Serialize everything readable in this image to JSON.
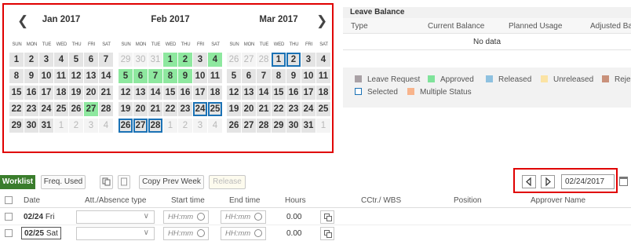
{
  "calendar": {
    "weekday_labels": [
      "SUN",
      "MON",
      "TUE",
      "WED",
      "THU",
      "FRI",
      "SAT"
    ],
    "prev_icon": "chevron-left-icon",
    "next_icon": "chevron-right-icon",
    "months": [
      {
        "title": "Jan 2017",
        "weeks": [
          [
            {
              "d": "1"
            },
            {
              "d": "2"
            },
            {
              "d": "3"
            },
            {
              "d": "4"
            },
            {
              "d": "5"
            },
            {
              "d": "6"
            },
            {
              "d": "7"
            }
          ],
          [
            {
              "d": "8"
            },
            {
              "d": "9"
            },
            {
              "d": "10"
            },
            {
              "d": "11"
            },
            {
              "d": "12"
            },
            {
              "d": "13"
            },
            {
              "d": "14"
            }
          ],
          [
            {
              "d": "15"
            },
            {
              "d": "16"
            },
            {
              "d": "17"
            },
            {
              "d": "18"
            },
            {
              "d": "19"
            },
            {
              "d": "20"
            },
            {
              "d": "21"
            }
          ],
          [
            {
              "d": "22"
            },
            {
              "d": "23"
            },
            {
              "d": "24"
            },
            {
              "d": "25"
            },
            {
              "d": "26"
            },
            {
              "d": "27",
              "s": "approved"
            },
            {
              "d": "28"
            }
          ],
          [
            {
              "d": "29"
            },
            {
              "d": "30"
            },
            {
              "d": "31"
            },
            {
              "d": "1",
              "s": "other"
            },
            {
              "d": "2",
              "s": "other"
            },
            {
              "d": "3",
              "s": "other"
            },
            {
              "d": "4",
              "s": "other"
            }
          ]
        ]
      },
      {
        "title": "Feb 2017",
        "weeks": [
          [
            {
              "d": "29",
              "s": "other"
            },
            {
              "d": "30",
              "s": "other"
            },
            {
              "d": "31",
              "s": "other"
            },
            {
              "d": "1",
              "s": "approved"
            },
            {
              "d": "2",
              "s": "approved"
            },
            {
              "d": "3"
            },
            {
              "d": "4",
              "s": "approved"
            }
          ],
          [
            {
              "d": "5",
              "s": "approved"
            },
            {
              "d": "6",
              "s": "approved"
            },
            {
              "d": "7",
              "s": "approved"
            },
            {
              "d": "8",
              "s": "approved"
            },
            {
              "d": "9",
              "s": "approved"
            },
            {
              "d": "10"
            },
            {
              "d": "11"
            }
          ],
          [
            {
              "d": "12"
            },
            {
              "d": "13"
            },
            {
              "d": "14"
            },
            {
              "d": "15"
            },
            {
              "d": "16"
            },
            {
              "d": "17"
            },
            {
              "d": "18"
            }
          ],
          [
            {
              "d": "19"
            },
            {
              "d": "20"
            },
            {
              "d": "21"
            },
            {
              "d": "22"
            },
            {
              "d": "23"
            },
            {
              "d": "24",
              "s": "selected"
            },
            {
              "d": "25",
              "s": "selected"
            }
          ],
          [
            {
              "d": "26",
              "s": "selected"
            },
            {
              "d": "27",
              "s": "selected"
            },
            {
              "d": "28",
              "s": "selected"
            },
            {
              "d": "1",
              "s": "other"
            },
            {
              "d": "2",
              "s": "other"
            },
            {
              "d": "3",
              "s": "other"
            },
            {
              "d": "4",
              "s": "other"
            }
          ]
        ]
      },
      {
        "title": "Mar 2017",
        "weeks": [
          [
            {
              "d": "26",
              "s": "other"
            },
            {
              "d": "27",
              "s": "other"
            },
            {
              "d": "28",
              "s": "other"
            },
            {
              "d": "1",
              "s": "selected"
            },
            {
              "d": "2",
              "s": "selected"
            },
            {
              "d": "3"
            },
            {
              "d": "4"
            }
          ],
          [
            {
              "d": "5"
            },
            {
              "d": "6"
            },
            {
              "d": "7"
            },
            {
              "d": "8"
            },
            {
              "d": "9"
            },
            {
              "d": "10"
            },
            {
              "d": "11"
            }
          ],
          [
            {
              "d": "12"
            },
            {
              "d": "13"
            },
            {
              "d": "14"
            },
            {
              "d": "15"
            },
            {
              "d": "16"
            },
            {
              "d": "17"
            },
            {
              "d": "18"
            }
          ],
          [
            {
              "d": "19"
            },
            {
              "d": "20"
            },
            {
              "d": "21"
            },
            {
              "d": "22"
            },
            {
              "d": "23"
            },
            {
              "d": "24"
            },
            {
              "d": "25"
            }
          ],
          [
            {
              "d": "26"
            },
            {
              "d": "27"
            },
            {
              "d": "28"
            },
            {
              "d": "29"
            },
            {
              "d": "30"
            },
            {
              "d": "31"
            },
            {
              "d": "1",
              "s": "other"
            }
          ]
        ]
      }
    ]
  },
  "leave_balance": {
    "title": "Leave Balance",
    "columns": [
      "Type",
      "Current Balance",
      "Planned Usage",
      "Adjusted Ba"
    ],
    "empty_text": "No data"
  },
  "legend": {
    "items": [
      {
        "label": "Leave Request",
        "color": "#a9a1a5"
      },
      {
        "label": "Approved",
        "color": "#7fe39a"
      },
      {
        "label": "Released",
        "color": "#8ec1e0"
      },
      {
        "label": "Unreleased",
        "color": "#fbe3a4"
      },
      {
        "label": "Reje",
        "color": "#c9917b"
      },
      {
        "label": "Selected",
        "color": "#1b72b5"
      },
      {
        "label": "Multiple Status",
        "color": "#f8b48c"
      }
    ]
  },
  "toolbar": {
    "worklist": "Worklist",
    "freq_used": "Freq. Used",
    "copy_prev_week": "Copy Prev Week",
    "release": "Release",
    "current_date": "02/24/2017",
    "prev_icon": "triangle-left-icon",
    "next_icon": "triangle-right-icon",
    "calendar_icon": "calendar-icon"
  },
  "table": {
    "headers": [
      "Date",
      "Att./Absence type",
      "Start time",
      "End time",
      "Hours",
      "CCtr./ WBS",
      "Position",
      "Approver Name"
    ],
    "time_placeholder": "HH:mm",
    "rows": [
      {
        "date": "02/24",
        "weekday": "Fri",
        "hours": "0.00"
      },
      {
        "date": "02/25",
        "weekday": "Sat",
        "hours": "0.00"
      }
    ]
  }
}
